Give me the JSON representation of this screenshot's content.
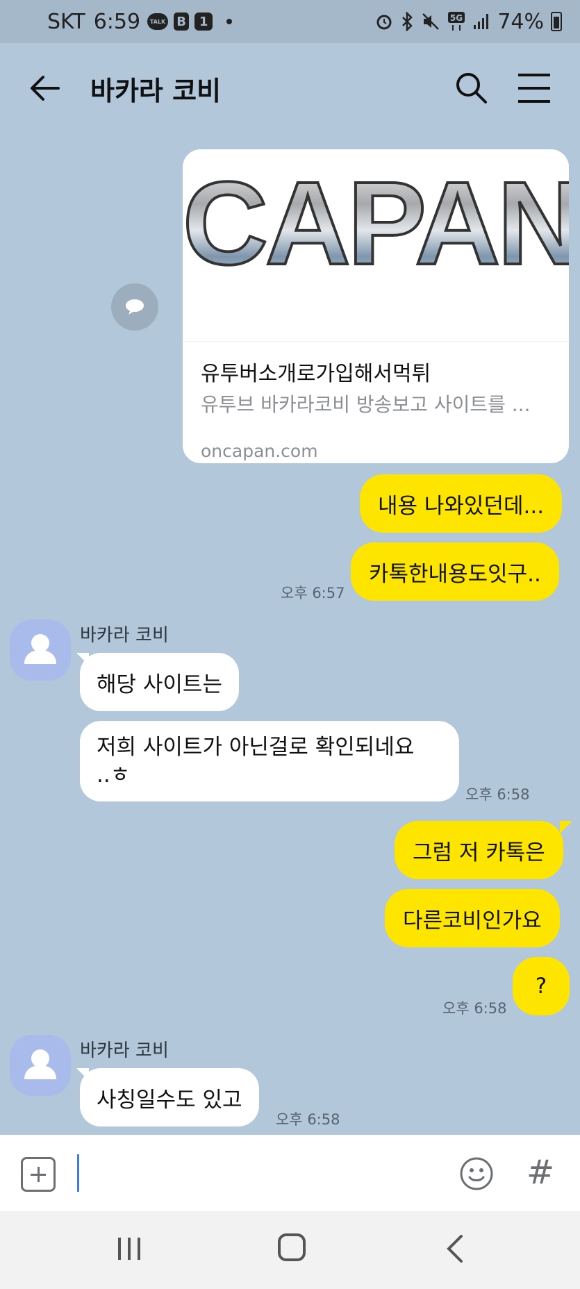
{
  "status_bar": {
    "carrier": "SKT",
    "time": "6:59",
    "battery": "74%",
    "icons": [
      "kakaotalk-notification-icon",
      "b-app-icon",
      "one-app-icon",
      "alarm-icon",
      "bluetooth-icon",
      "mute-icon",
      "5g-icon",
      "signal-icon",
      "battery-icon"
    ]
  },
  "header": {
    "title": "바카라 코비",
    "icons": [
      "back-arrow-icon",
      "search-icon",
      "menu-icon"
    ]
  },
  "link_preview": {
    "image_text": "CAPAN",
    "title": "유투버소개로가입해서먹튀",
    "description": "유투브 바카라코비 방송보고 사이트를 ...",
    "domain": "oncapan.com"
  },
  "messages": {
    "me_1": "내용 나와있던데...",
    "me_2": "카톡한내용도잇구..",
    "me_time_1": "오후 6:57",
    "other_name_1": "바카라 코비",
    "other_1": "해당 사이트는",
    "other_2_line1": "저희 사이트가 아닌걸로 확인되네요",
    "other_2_line2": "..ㅎ",
    "other_time_1": "오후 6:58",
    "me_3": "그럼 저 카톡은",
    "me_4": "다른코비인가요",
    "me_5": "?",
    "me_time_2": "오후 6:58",
    "other_name_2": "바카라 코비",
    "other_3": "사칭일수도 있고",
    "other_time_2": "오후 6:58"
  },
  "input_bar": {
    "value": "",
    "hash_symbol": "#",
    "icons": [
      "plus-icon",
      "emoji-icon",
      "hash-icon"
    ]
  },
  "nav_bar": {
    "icons": [
      "recent-apps-icon",
      "home-icon",
      "back-icon"
    ]
  },
  "colors": {
    "chat_background": "#b2c7da",
    "my_bubble": "#fee500",
    "other_bubble": "#ffffff",
    "avatar": "#a9bbeb"
  }
}
